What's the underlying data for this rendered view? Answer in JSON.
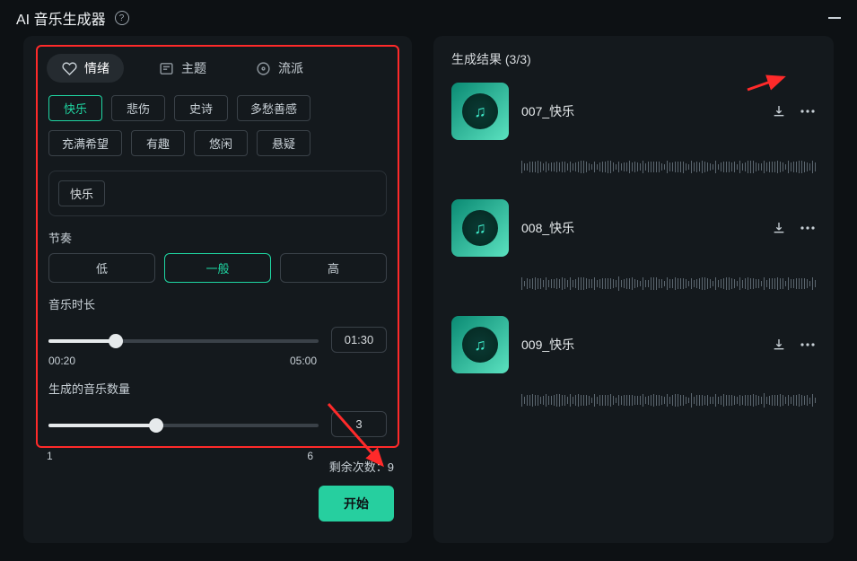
{
  "titlebar": {
    "title": "AI 音乐生成器"
  },
  "left": {
    "tabs": [
      {
        "label": "情绪",
        "icon": "heart-icon",
        "active": true
      },
      {
        "label": "主题",
        "icon": "list-icon",
        "active": false
      },
      {
        "label": "流派",
        "icon": "disc-icon",
        "active": false
      }
    ],
    "mood_chips": [
      {
        "label": "快乐",
        "active": true
      },
      {
        "label": "悲伤",
        "active": false
      },
      {
        "label": "史诗",
        "active": false
      },
      {
        "label": "多愁善感",
        "active": false
      },
      {
        "label": "充满希望",
        "active": false
      },
      {
        "label": "有趣",
        "active": false
      },
      {
        "label": "悠闲",
        "active": false
      },
      {
        "label": "悬疑",
        "active": false
      }
    ],
    "selected_tag": "快乐",
    "tempo": {
      "label": "节奏",
      "options": [
        {
          "label": "低",
          "active": false
        },
        {
          "label": "一般",
          "active": true
        },
        {
          "label": "高",
          "active": false
        }
      ]
    },
    "duration": {
      "label": "音乐时长",
      "min_label": "00:20",
      "max_label": "05:00",
      "value_label": "01:30",
      "fill_pct": 25
    },
    "count": {
      "label": "生成的音乐数量",
      "min_label": "1",
      "max_label": "6",
      "value_label": "3",
      "fill_pct": 40
    },
    "remaining": {
      "prefix": "剩余次数：",
      "value": "9"
    },
    "start_label": "开始"
  },
  "right": {
    "title_prefix": "生成结果 ",
    "title_count": "(3/3)",
    "results": [
      {
        "name": "007_快乐"
      },
      {
        "name": "008_快乐"
      },
      {
        "name": "009_快乐"
      }
    ]
  }
}
